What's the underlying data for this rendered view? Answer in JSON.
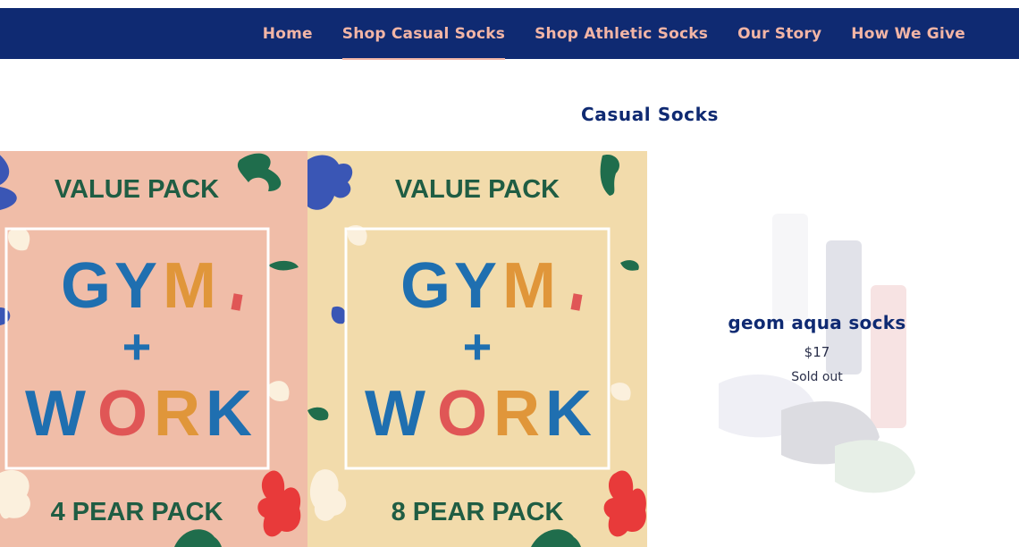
{
  "nav": {
    "items": [
      {
        "label": "Home",
        "active": false
      },
      {
        "label": "Shop Casual Socks",
        "active": true
      },
      {
        "label": "Shop Athletic Socks",
        "active": false
      },
      {
        "label": "Our Story",
        "active": false
      },
      {
        "label": "How We Give",
        "active": false
      }
    ]
  },
  "collection": {
    "title": "Casual Socks"
  },
  "products": [
    {
      "header": "VALUE PACK",
      "line1_letters": [
        "G",
        "Y",
        "M"
      ],
      "plus": "+",
      "line2_letters": [
        "W",
        "O",
        "R",
        "K"
      ],
      "footer": "4 PEAR PACK",
      "bg_color": "#f0bda8"
    },
    {
      "header": "VALUE PACK",
      "line1_letters": [
        "G",
        "Y",
        "M"
      ],
      "plus": "+",
      "line2_letters": [
        "W",
        "O",
        "R",
        "K"
      ],
      "footer": "8 PEAR PACK",
      "bg_color": "#f2dbab"
    },
    {
      "name": "geom aqua socks",
      "price": "$17",
      "status": "Sold out"
    }
  ],
  "colors": {
    "navy": "#0f2a72",
    "nav_text": "#f2b5a6",
    "pack_green": "#1f5d43",
    "letter_blue": "#1f6fb0",
    "letter_orange": "#e0963a",
    "letter_red": "#e05656",
    "shape_blue": "#3a56b5",
    "shape_green": "#1f6d4c",
    "shape_red": "#e83a3a",
    "shape_cream": "#fbf0dd"
  }
}
